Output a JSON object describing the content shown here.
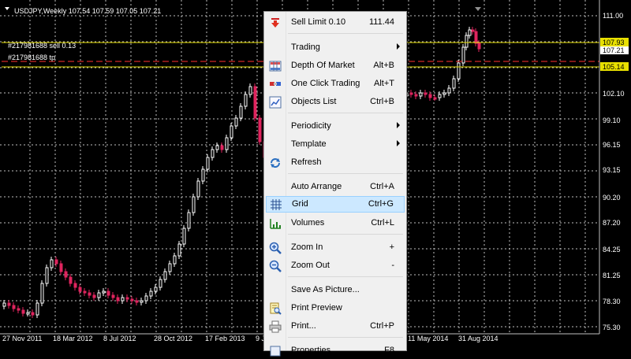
{
  "chart": {
    "header": "USDJPY,Weekly  107.54 107.59 107.05 107.21",
    "orders": [
      {
        "label": "#217981688 sell 0.13"
      },
      {
        "label": "#217981688 tp"
      }
    ],
    "price_labels": [
      "111.00",
      "107.93",
      "107.21",
      "105.14",
      "102.10",
      "99.10",
      "96.15",
      "93.15",
      "90.20",
      "87.20",
      "84.25",
      "81.25",
      "78.30",
      "75.30"
    ],
    "date_labels": [
      "27 Nov 2011",
      "18 Mar 2012",
      "8 Jul 2012",
      "28 Oct 2012",
      "17 Feb 2013",
      "9 J",
      "11 May 2014",
      "31 Aug 2014"
    ],
    "colors": {
      "background": "#000000",
      "grid": "#c0c0c0",
      "bull": "#ffffff",
      "bear": "#e0245e",
      "order_line": "#e8e000",
      "tp_line": "#ff3030"
    }
  },
  "menu": {
    "items": [
      {
        "label": "Sell Limit 0.10",
        "shortcut": "111.44",
        "icon": "sell-limit-icon",
        "submenu": false
      },
      {
        "label": "Trading",
        "shortcut": "",
        "icon": "",
        "submenu": true
      },
      {
        "label": "Depth Of Market",
        "shortcut": "Alt+B",
        "icon": "depth-of-market-icon",
        "submenu": false
      },
      {
        "label": "One Click Trading",
        "shortcut": "Alt+T",
        "icon": "one-click-trading-icon",
        "submenu": false
      },
      {
        "label": "Objects List",
        "shortcut": "Ctrl+B",
        "icon": "objects-list-icon",
        "submenu": false
      },
      {
        "label": "Periodicity",
        "shortcut": "",
        "icon": "",
        "submenu": true
      },
      {
        "label": "Template",
        "shortcut": "",
        "icon": "",
        "submenu": true
      },
      {
        "label": "Refresh",
        "shortcut": "",
        "icon": "refresh-icon",
        "submenu": false
      },
      {
        "label": "Auto Arrange",
        "shortcut": "Ctrl+A",
        "icon": "",
        "submenu": false
      },
      {
        "label": "Grid",
        "shortcut": "Ctrl+G",
        "icon": "grid-icon",
        "submenu": false,
        "highlighted": true
      },
      {
        "label": "Volumes",
        "shortcut": "Ctrl+L",
        "icon": "volumes-icon",
        "submenu": false
      },
      {
        "label": "Zoom In",
        "shortcut": "+",
        "icon": "zoom-in-icon",
        "submenu": false
      },
      {
        "label": "Zoom Out",
        "shortcut": "-",
        "icon": "zoom-out-icon",
        "submenu": false
      },
      {
        "label": "Save As Picture...",
        "shortcut": "",
        "icon": "",
        "submenu": false
      },
      {
        "label": "Print Preview",
        "shortcut": "",
        "icon": "print-preview-icon",
        "submenu": false
      },
      {
        "label": "Print...",
        "shortcut": "Ctrl+P",
        "icon": "print-icon",
        "submenu": false
      },
      {
        "label": "Properties...",
        "shortcut": "F8",
        "icon": "properties-icon",
        "submenu": false
      }
    ]
  }
}
